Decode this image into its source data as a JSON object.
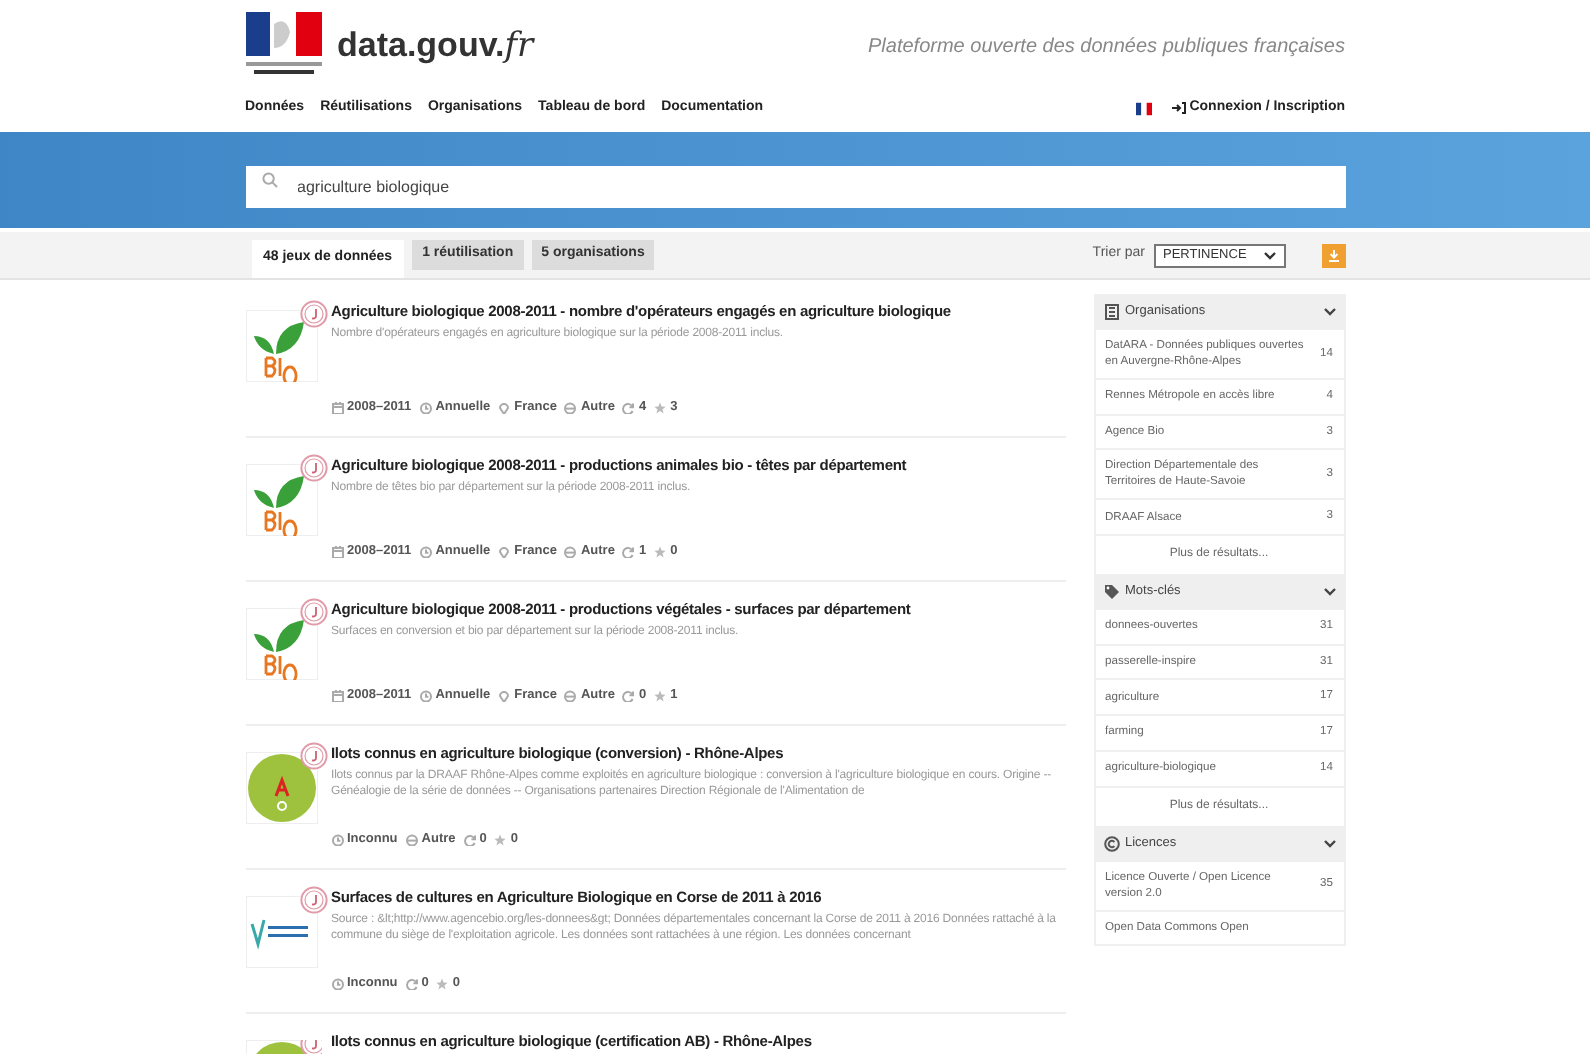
{
  "header": {
    "site_name": "data.gouv.",
    "site_tld": "fr",
    "tagline": "Plateforme ouverte des données publiques françaises"
  },
  "nav": {
    "items": [
      "Données",
      "Réutilisations",
      "Organisations",
      "Tableau de bord",
      "Documentation"
    ],
    "login": "Connexion / Inscription"
  },
  "search": {
    "value": "agriculture biologique"
  },
  "tabs": [
    {
      "label": "48 jeux de données",
      "selected": true
    },
    {
      "label": "1 réutilisation",
      "selected": false
    },
    {
      "label": "5 organisations",
      "selected": false
    }
  ],
  "sort": {
    "label": "Trier par",
    "value": "PERTINENCE"
  },
  "results": [
    {
      "kind": "agencebio",
      "title": "Agriculture biologique 2008-2011 - nombre d'opérateurs engagés en agriculture biologique",
      "description": "Nombre d'opérateurs engagés en agriculture biologique sur la période 2008-2011 inclus.",
      "meta": [
        {
          "kind": "period",
          "text": "2008–2011"
        },
        {
          "kind": "frequency",
          "text": "Annuelle"
        },
        {
          "kind": "spatial",
          "text": "France"
        },
        {
          "kind": "license",
          "text": "Autre"
        },
        {
          "kind": "reuses",
          "text": "4"
        },
        {
          "kind": "stars",
          "text": "3"
        }
      ]
    },
    {
      "kind": "agencebio",
      "title": "Agriculture biologique 2008-2011 - productions animales bio - têtes par département",
      "description": "Nombre de têtes bio par département sur la période 2008-2011 inclus.",
      "meta": [
        {
          "kind": "period",
          "text": "2008–2011"
        },
        {
          "kind": "frequency",
          "text": "Annuelle"
        },
        {
          "kind": "spatial",
          "text": "France"
        },
        {
          "kind": "license",
          "text": "Autre"
        },
        {
          "kind": "reuses",
          "text": "1"
        },
        {
          "kind": "stars",
          "text": "0"
        }
      ]
    },
    {
      "kind": "agencebio",
      "title": "Agriculture biologique 2008-2011 - productions végétales - surfaces par département",
      "description": "Surfaces en conversion et bio par département sur la période 2008-2011 inclus.",
      "meta": [
        {
          "kind": "period",
          "text": "2008–2011"
        },
        {
          "kind": "frequency",
          "text": "Annuelle"
        },
        {
          "kind": "spatial",
          "text": "France"
        },
        {
          "kind": "license",
          "text": "Autre"
        },
        {
          "kind": "reuses",
          "text": "0"
        },
        {
          "kind": "stars",
          "text": "1"
        }
      ]
    },
    {
      "kind": "datara",
      "title": "Ilots connus en agriculture biologique (conversion) - Rhône-Alpes",
      "description": "Ilots connus par la DRAAF Rhône-Alpes comme exploités en agriculture biologique : conversion à l'agriculture biologique en cours. Origine -- Généalogie de la série de données -- Organisations partenaires Direction Régionale de l'Alimentation de",
      "meta": [
        {
          "kind": "frequency",
          "text": "Inconnu"
        },
        {
          "kind": "license",
          "text": "Autre"
        },
        {
          "kind": "reuses",
          "text": "0"
        },
        {
          "kind": "stars",
          "text": "0"
        }
      ]
    },
    {
      "kind": "corse",
      "title": "Surfaces de cultures en Agriculture Biologique en Corse de 2011 à 2016",
      "description": "Source : &lt;http://www.agencebio.org/les-donnees&gt; Données départementales concernant la Corse de 2011 à 2016 Données rattaché à la commune du siège de l'exploitation agricole. Les données sont rattachées à une région. Les données concernant",
      "meta": [
        {
          "kind": "frequency",
          "text": "Inconnu"
        },
        {
          "kind": "reuses",
          "text": "0"
        },
        {
          "kind": "stars",
          "text": "0"
        }
      ]
    },
    {
      "kind": "datara",
      "title": "Ilots connus en agriculture biologique (certification AB) - Rhône-Alpes"
    }
  ],
  "facets": [
    {
      "kind": "organisations",
      "title": "Organisations",
      "items": [
        {
          "label": "DatARA - Données publiques ouvertes en Auvergne-Rhône-Alpes",
          "count": "14"
        },
        {
          "label": "Rennes Métropole en accès libre",
          "count": "4"
        },
        {
          "label": "Agence Bio",
          "count": "3"
        },
        {
          "label": "Direction Départementale des Territoires de Haute-Savoie",
          "count": "3"
        },
        {
          "label": "DRAAF Alsace",
          "count": "3"
        }
      ],
      "more": "Plus de résultats..."
    },
    {
      "kind": "tags",
      "title": "Mots-clés",
      "items": [
        {
          "label": "donnees-ouvertes",
          "count": "31"
        },
        {
          "label": "passerelle-inspire",
          "count": "31"
        },
        {
          "label": "agriculture",
          "count": "17"
        },
        {
          "label": "farming",
          "count": "17"
        },
        {
          "label": "agriculture-biologique",
          "count": "14"
        }
      ],
      "more": "Plus de résultats..."
    },
    {
      "kind": "licenses",
      "title": "Licences",
      "items": [
        {
          "label": "Licence Ouverte / Open Licence version 2.0",
          "count": "35"
        },
        {
          "label": "Open Data Commons Open"
        }
      ]
    }
  ]
}
